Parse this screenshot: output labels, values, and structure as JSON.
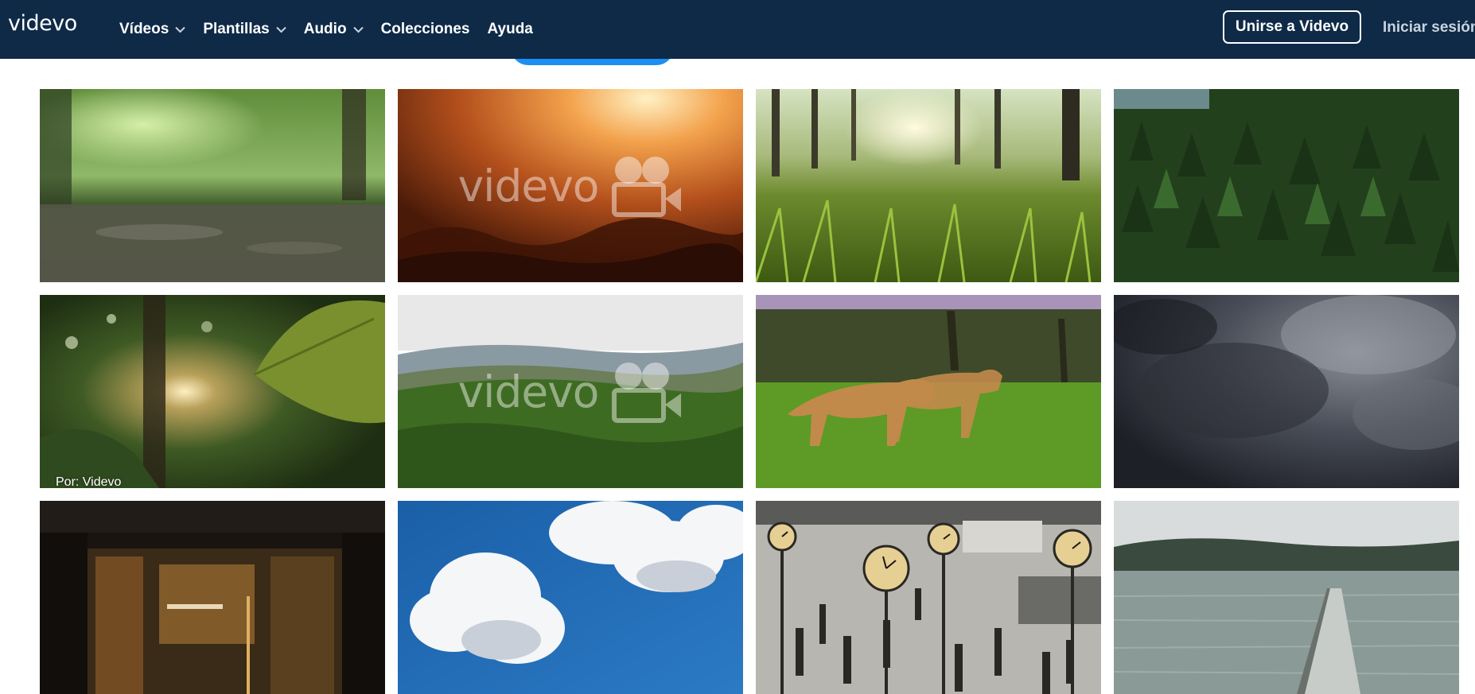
{
  "brand": {
    "logo": "videvo"
  },
  "nav": {
    "items": [
      {
        "label": "Vídeos",
        "dropdown": true
      },
      {
        "label": "Plantillas",
        "dropdown": true
      },
      {
        "label": "Audio",
        "dropdown": true
      },
      {
        "label": "Colecciones",
        "dropdown": false
      },
      {
        "label": "Ayuda",
        "dropdown": false
      }
    ],
    "join_label": "Unirse a Videvo",
    "signin_label": "Iniciar sesión"
  },
  "grid": {
    "watermark_text": "videvo",
    "byline": "Por: Videvo",
    "cards": [
      {
        "scene": "rain-forest-floor"
      },
      {
        "scene": "sunrise-forest-mist",
        "watermark": true
      },
      {
        "scene": "grass-sunlight"
      },
      {
        "scene": "pine-forest-aerial"
      },
      {
        "scene": "jungle-leaf-sun",
        "byline": true
      },
      {
        "scene": "green-hills-forest",
        "watermark": true
      },
      {
        "scene": "lionesses-walking"
      },
      {
        "scene": "dark-storm-clouds"
      },
      {
        "scene": "night-building-lobby"
      },
      {
        "scene": "blue-sky-clouds"
      },
      {
        "scene": "city-square-clocks"
      },
      {
        "scene": "lake-pier-fog"
      }
    ]
  },
  "colors": {
    "navbar": "#0e2a47",
    "accent": "#1d8ff0"
  }
}
